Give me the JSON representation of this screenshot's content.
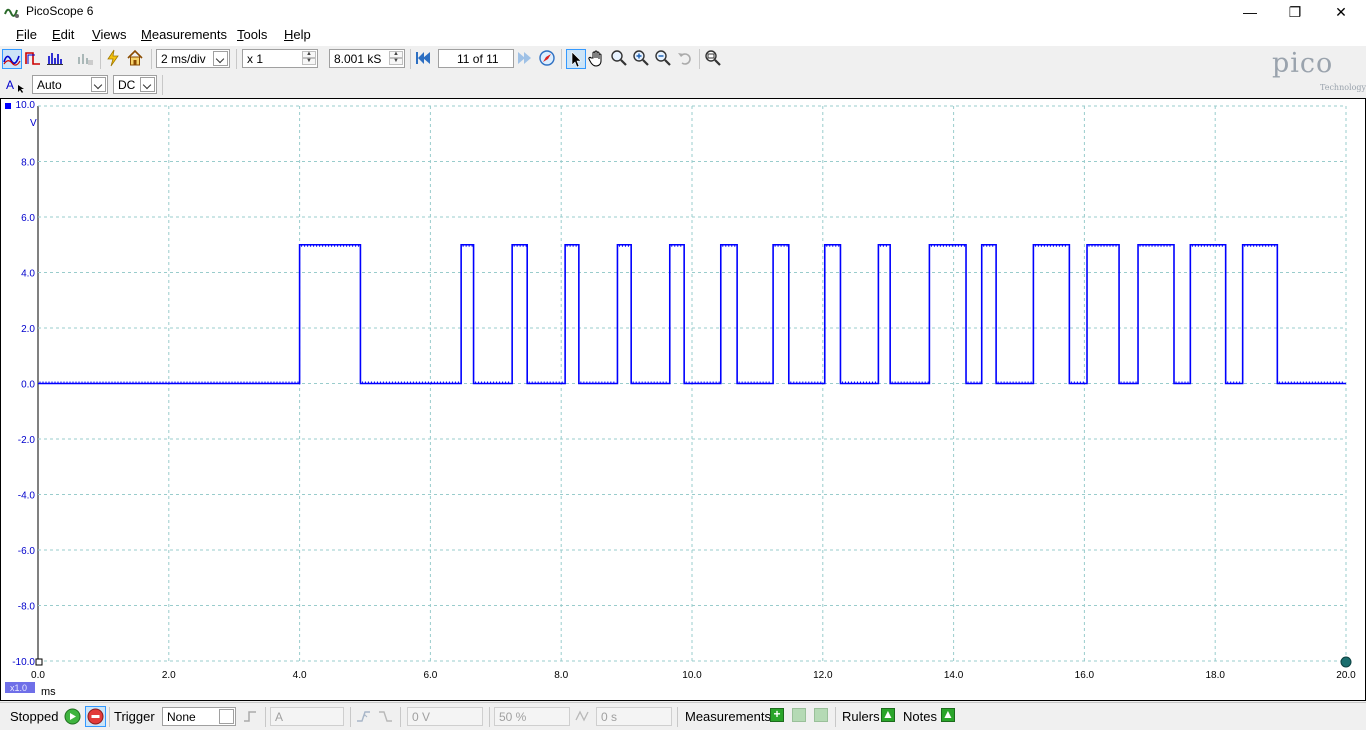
{
  "window": {
    "title": "PicoScope 6",
    "minimize": "—",
    "restore": "❐",
    "close": "✕"
  },
  "menu": [
    {
      "label": "File",
      "u": "F",
      "rest": "ile"
    },
    {
      "label": "Edit",
      "u": "E",
      "rest": "dit"
    },
    {
      "label": "Views",
      "u": "V",
      "rest": "iews"
    },
    {
      "label": "Measurements",
      "u": "M",
      "rest": "easurements"
    },
    {
      "label": "Tools",
      "u": "T",
      "rest": "ools"
    },
    {
      "label": "Help",
      "u": "H",
      "rest": "elp"
    }
  ],
  "toolbar": {
    "timebase": "2 ms/div",
    "zoom_factor": "x 1",
    "samples": "8.001 kS",
    "buffer_position": "11 of 11"
  },
  "channel": {
    "name": "A",
    "range": "Auto",
    "coupling": "DC"
  },
  "logo": {
    "text": "pico",
    "subtext": "Technology"
  },
  "chart_data": {
    "type": "line",
    "y_unit": "V",
    "x_unit": "ms",
    "scale_badge": "x1.0",
    "ylim": [
      -10.0,
      10.0
    ],
    "xlim": [
      0.0,
      20.0
    ],
    "y_ticks": [
      "10.0",
      "8.0",
      "6.0",
      "4.0",
      "2.0",
      "0.0",
      "-2.0",
      "-4.0",
      "-6.0",
      "-8.0",
      "-10.0"
    ],
    "x_ticks": [
      "0.0",
      "2.0",
      "4.0",
      "6.0",
      "8.0",
      "10.0",
      "12.0",
      "14.0",
      "16.0",
      "18.0",
      "20.0"
    ],
    "grid": true,
    "series": [
      {
        "color": "#0000ff",
        "low": 0.0,
        "high": 5.0,
        "pulses": [
          [
            4.0,
            4.93
          ],
          [
            6.47,
            6.66
          ],
          [
            7.25,
            7.48
          ],
          [
            8.06,
            8.27
          ],
          [
            8.86,
            9.07
          ],
          [
            9.66,
            9.88
          ],
          [
            10.44,
            10.69
          ],
          [
            11.24,
            11.48
          ],
          [
            12.03,
            12.27
          ],
          [
            12.85,
            13.03
          ],
          [
            13.63,
            14.19
          ],
          [
            14.43,
            14.65
          ],
          [
            15.22,
            15.77
          ],
          [
            16.04,
            16.53
          ],
          [
            16.82,
            17.37
          ],
          [
            17.62,
            18.16
          ],
          [
            18.42,
            18.95
          ]
        ]
      }
    ]
  },
  "status": {
    "state": "Stopped",
    "trigger_label": "Trigger",
    "trigger_mode": "None",
    "trigger_source": "A",
    "threshold": "0 V",
    "pre_trigger": "50 %",
    "delay": "0 s",
    "measurements_label": "Measurements",
    "rulers_label": "Rulers",
    "notes_label": "Notes"
  }
}
